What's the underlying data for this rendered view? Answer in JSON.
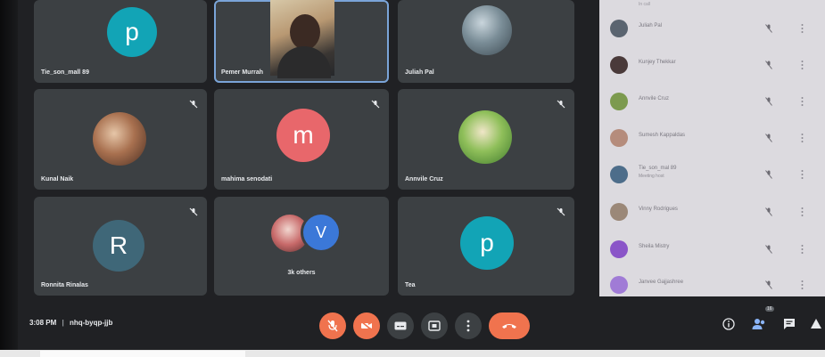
{
  "meeting": {
    "time": "3:08 PM",
    "separator": "|",
    "code": "nhq-byqp-jjb"
  },
  "tiles": [
    {
      "name": "Tie_son_mall 89",
      "avatar_letter": "p",
      "avatar_color": "#12a4b6",
      "type": "letter"
    },
    {
      "name": "Pemer Murrah",
      "type": "video"
    },
    {
      "name": "Juliah Pal",
      "type": "photo"
    },
    {
      "name": "Kunal Naik",
      "type": "photo"
    },
    {
      "name": "mahima senodati",
      "avatar_letter": "m",
      "avatar_color": "#e8676b",
      "type": "letter"
    },
    {
      "name": "Annvile Cruz",
      "type": "photo"
    },
    {
      "name": "Ronnita Rinalas",
      "avatar_letter": "R",
      "avatar_color": "#3f6778",
      "type": "letter"
    },
    {
      "name": "3k others",
      "avatar_letter": "V",
      "avatar_color": "#3b78d8",
      "type": "group"
    },
    {
      "name": "Tea",
      "avatar_letter": "p",
      "avatar_color": "#12a4b6",
      "type": "letter"
    }
  ],
  "participants_panel": {
    "header": "In call",
    "rows": [
      {
        "name": "Juliah Pal",
        "sub": "",
        "avatar_color": "#5a6470"
      },
      {
        "name": "Kunjey Thekkar",
        "sub": "",
        "avatar_color": "#4a3a3a"
      },
      {
        "name": "Annvile Cruz",
        "sub": "",
        "avatar_color": "#7c9a4e"
      },
      {
        "name": "Sumesh Kappaldas",
        "sub": "",
        "avatar_color": "#b58c7c"
      },
      {
        "name": "Tie_son_mal 89",
        "sub": "Meeting host",
        "avatar_color": "#4d6d8a"
      },
      {
        "name": "Vinny Rodrigues",
        "sub": "",
        "avatar_color": "#9b8878"
      },
      {
        "name": "Sheila Mistry",
        "sub": "",
        "avatar_color": "#8a55c8"
      },
      {
        "name": "Janvee Gajjashree",
        "sub": "",
        "avatar_color": "#a07bd6"
      }
    ]
  },
  "controls": {
    "mic": "mic-off-icon",
    "camera": "camera-off-icon",
    "captions": "captions-icon",
    "present": "present-screen-icon",
    "more": "more-options-icon",
    "end_call": "end-call-icon"
  },
  "right_controls": {
    "info": "info-icon",
    "people": "people-icon",
    "people_count": "16",
    "chat": "chat-icon",
    "activities": "activities-icon"
  },
  "colors": {
    "tile_bg": "#3c4043",
    "stage_bg": "#202124",
    "accent_red": "#f0734e",
    "panel_bg": "#dcdadf",
    "active_border": "#7aa4d8"
  }
}
